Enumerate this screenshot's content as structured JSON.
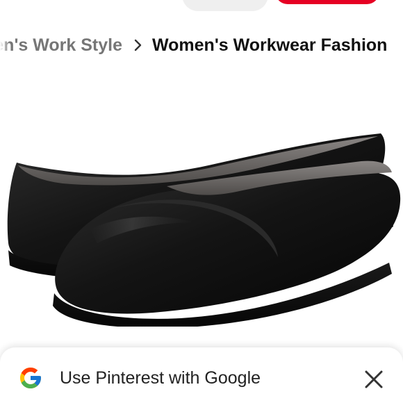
{
  "header": {
    "brand_color": "#e60023"
  },
  "breadcrumb": {
    "previous": "en's Work Style",
    "separator_icon": "chevron-right-icon",
    "current": "Women's Workwear Fashion"
  },
  "pin": {
    "image": "black-leather-flat-shoes"
  },
  "banner": {
    "logo": "google-g-icon",
    "text": "Use Pinterest with Google",
    "close_icon": "close-icon"
  }
}
